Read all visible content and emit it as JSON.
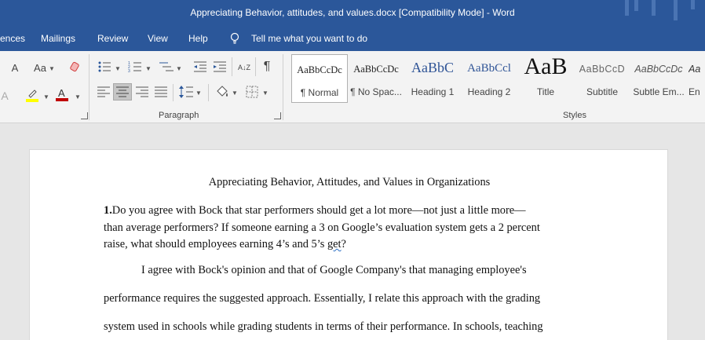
{
  "window": {
    "title": "Appreciating Behavior, attitudes, and values.docx [Compatibility Mode]  -  Word"
  },
  "tabs": {
    "references_partial": "ences",
    "mailings": "Mailings",
    "review": "Review",
    "view": "View",
    "help": "Help",
    "tell_me": "Tell me what you want to do"
  },
  "ribbon": {
    "font": {
      "change_case": "Aa",
      "shrink_a": "A",
      "highlight_color": "#ffff00",
      "font_color": "#c00000"
    },
    "paragraph": {
      "label": "Paragraph",
      "sort": "A↓Z",
      "pilcrow": "¶"
    },
    "styles": {
      "label": "Styles",
      "items": [
        {
          "preview": "AaBbCcDc",
          "name": "¶ Normal",
          "selected": true
        },
        {
          "preview": "AaBbCcDc",
          "name": "¶ No Spac..."
        },
        {
          "preview": "AaBbC",
          "name": "Heading 1"
        },
        {
          "preview": "AaBbCcl",
          "name": "Heading 2"
        },
        {
          "preview": "AaB",
          "name": "Title"
        },
        {
          "preview": "AaBbCcD",
          "name": "Subtitle"
        },
        {
          "preview": "AaBbCcDc",
          "name": "Subtle Em..."
        },
        {
          "preview": "Aa",
          "name": "En"
        }
      ]
    }
  },
  "document": {
    "title": "Appreciating Behavior, Attitudes, and Values in Organizations",
    "question_number": "1.",
    "question_line1": "Do you agree with Bock that star performers should get a lot more—not just a little more—",
    "question_line2": "than average performers? If someone earning a 3 on Google’s evaluation system gets a 2 percent",
    "question_line3_a": "raise, what should employees earning 4’s and 5’s ",
    "question_line3_b": "get",
    "question_line3_c": "?",
    "para_lines": [
      "I agree with Bock's opinion and that of Google Company's that managing employee's",
      "performance requires the suggested approach. Essentially, I relate this approach with the grading",
      "system used in schools while grading students in terms of their performance. In schools, teaching"
    ]
  }
}
